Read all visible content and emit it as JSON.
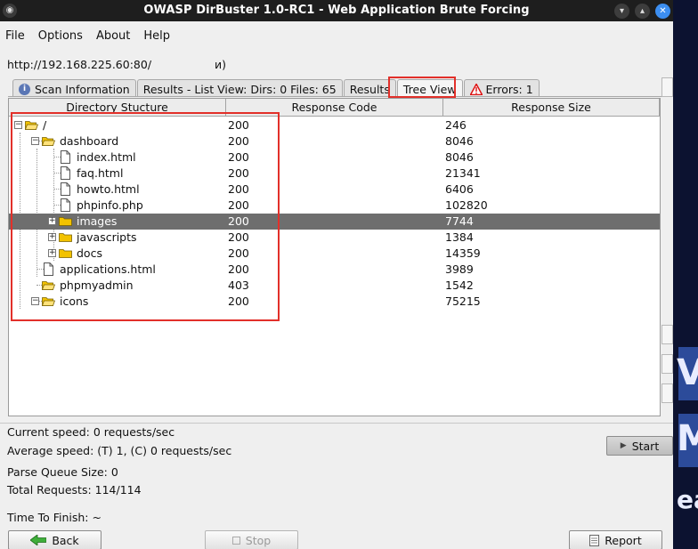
{
  "window": {
    "title": "OWASP DirBuster 1.0-RC1 - Web Application Brute Forcing",
    "min_icon": "minimize-icon",
    "max_icon": "maximize-icon",
    "close_icon": "close-icon"
  },
  "menu": [
    "File",
    "Options",
    "About",
    "Help"
  ],
  "target_url": "http://192.168.225.60:80/",
  "target_url_suffix": "и)",
  "tabs": {
    "scan_info": "Scan Information",
    "list_view": "Results - List View: Dirs: 0 Files: 65",
    "results": "Results",
    "tree_view": "Tree View",
    "errors": "Errors: 1"
  },
  "table": {
    "headers": [
      "Directory Stucture",
      "Response Code",
      "Response Size"
    ],
    "rows": [
      {
        "name": "/",
        "type": "folder-open",
        "code": "200",
        "size": "246",
        "depth": 0
      },
      {
        "name": "dashboard",
        "type": "folder-open",
        "code": "200",
        "size": "8046",
        "depth": 1
      },
      {
        "name": "index.html",
        "type": "file",
        "code": "200",
        "size": "8046",
        "depth": 2
      },
      {
        "name": "faq.html",
        "type": "file",
        "code": "200",
        "size": "21341",
        "depth": 2
      },
      {
        "name": "howto.html",
        "type": "file",
        "code": "200",
        "size": "6406",
        "depth": 2
      },
      {
        "name": "phpinfo.php",
        "type": "file",
        "code": "200",
        "size": "102820",
        "depth": 2
      },
      {
        "name": "images",
        "type": "folder",
        "code": "200",
        "size": "7744",
        "depth": 2,
        "selected": true
      },
      {
        "name": "javascripts",
        "type": "folder",
        "code": "200",
        "size": "1384",
        "depth": 2
      },
      {
        "name": "docs",
        "type": "folder",
        "code": "200",
        "size": "14359",
        "depth": 2
      },
      {
        "name": "applications.html",
        "type": "file",
        "code": "200",
        "size": "3989",
        "depth": 1
      },
      {
        "name": "phpmyadmin",
        "type": "folder-open",
        "code": "403",
        "size": "1542",
        "depth": 1
      },
      {
        "name": "icons",
        "type": "folder-open",
        "code": "200",
        "size": "75215",
        "depth": 1
      }
    ]
  },
  "status": {
    "current_speed": "Current speed: 0 requests/sec",
    "average_speed": "Average speed: (T) 1, (C) 0 requests/sec",
    "parse_queue": "Parse Queue Size: 0",
    "total_requests": "Total Requests: 114/114",
    "time_to_finish": "Time To Finish: ~"
  },
  "buttons": {
    "start": "Start",
    "back": "Back",
    "stop": "Stop",
    "report": "Report"
  },
  "colors": {
    "highlight_red": "#e2302a",
    "selected_row": "#6e6e6e",
    "folder": "#f2c200"
  },
  "desktop_letters": [
    "V",
    "M",
    "ea"
  ]
}
